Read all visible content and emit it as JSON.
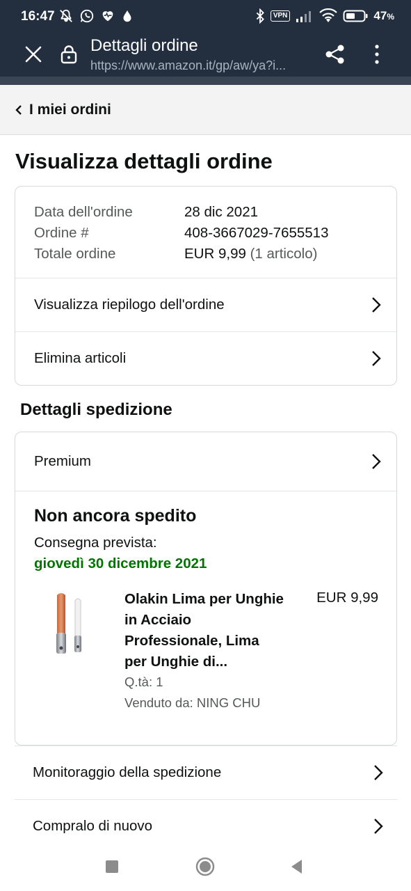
{
  "status_bar": {
    "time": "16:47",
    "battery_percent": "47",
    "battery_suffix": "%",
    "vpn_label": "VPN",
    "icons": [
      "silent-mode-icon",
      "whatsapp-icon",
      "health-icon",
      "drop-icon",
      "bluetooth-icon",
      "vpn-icon",
      "signal-icon",
      "wifi-icon",
      "battery-icon"
    ]
  },
  "browser": {
    "title": "Dettagli ordine",
    "url": "https://www.amazon.it/gp/aw/ya?i...",
    "icons": [
      "close-icon",
      "lock-icon",
      "share-icon",
      "more-vert-icon"
    ]
  },
  "breadcrumb": {
    "label": "I miei ordini"
  },
  "page": {
    "title": "Visualizza dettagli ordine"
  },
  "order_summary": {
    "rows": [
      {
        "label": "Data dell'ordine",
        "value": "28 dic 2021",
        "extra": ""
      },
      {
        "label": "Ordine #",
        "value": "408-3667029-7655513",
        "extra": ""
      },
      {
        "label": "Totale ordine",
        "value": "EUR 9,99",
        "extra": " (1 articolo)"
      }
    ],
    "links": [
      "Visualizza riepilogo dell'ordine",
      "Elimina articoli"
    ]
  },
  "shipment": {
    "section_title": "Dettagli spedizione",
    "method": "Premium",
    "status": "Non ancora spedito",
    "delivery_label": "Consegna prevista:",
    "delivery_date": "giovedì 30 dicembre 2021",
    "delivery_date_color": "#007600",
    "product": {
      "name": "Olakin Lima per Unghie in Acciaio Professionale, Lima per Unghie di...",
      "price": "EUR 9,99",
      "quantity": "Q.tà: 1",
      "seller": "Venduto da: NING CHU"
    }
  },
  "actions": [
    "Monitoraggio della spedizione",
    "Compralo di nuovo"
  ],
  "nav_bar": {
    "icons": [
      "recents-icon",
      "home-icon",
      "back-icon"
    ]
  },
  "colors": {
    "header_bg": "#232f3e",
    "breadcrumb_bg": "#f3f3f3",
    "border": "#d5d9d9"
  }
}
